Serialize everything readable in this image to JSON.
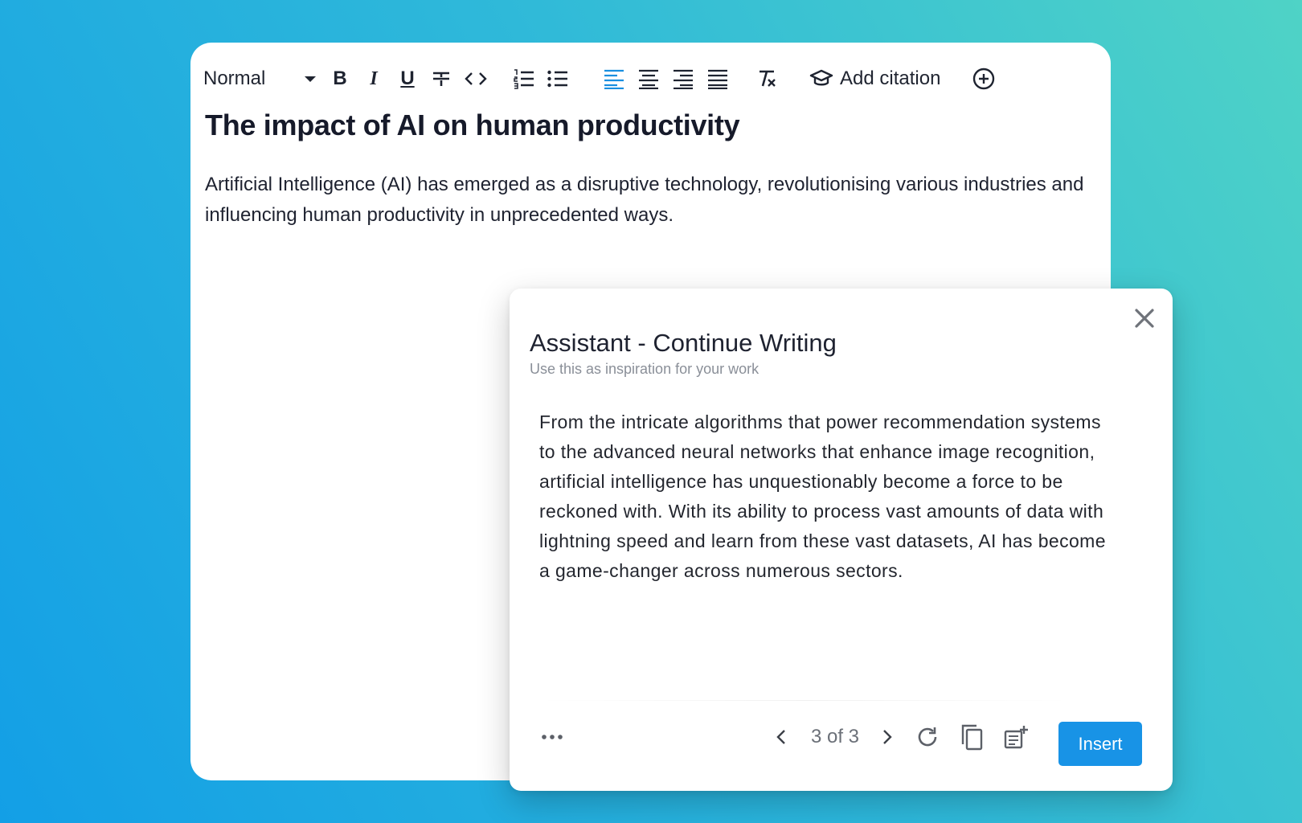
{
  "toolbar": {
    "style_select": {
      "value": "Normal"
    },
    "bold_label": "B",
    "italic_label": "I",
    "underline_label": "U",
    "add_citation_label": "Add citation",
    "icons": [
      "chevron-down-icon",
      "strikethrough-icon",
      "code-icon",
      "ordered-list-icon",
      "bullet-list-icon",
      "align-left-icon",
      "align-center-icon",
      "align-right-icon",
      "align-justify-icon",
      "clear-format-icon",
      "graduation-cap-icon",
      "plus-circle-icon"
    ],
    "active_color": "#1a8fe0"
  },
  "document": {
    "title": "The impact of AI on human productivity",
    "paragraph": "Artificial Intelligence (AI) has emerged as a disruptive technology, revolutionising various industries and influencing human productivity in unprecedented ways."
  },
  "assistant": {
    "title": "Assistant - Continue Writing",
    "subtitle": "Use this as inspiration for your work",
    "suggestion": "From the intricate algorithms that power recommendation systems to the advanced neural networks that enhance image recognition, artificial intelligence has unquestionably become a force to be reckoned with. With its ability to process vast amounts of data with lightning speed and learn from these vast datasets, AI has become a game-changer across numerous sectors.",
    "pagination": "3 of 3",
    "insert_label": "Insert",
    "icons": [
      "close-icon",
      "more-icon",
      "chevron-left-icon",
      "chevron-right-icon",
      "refresh-icon",
      "copy-icon",
      "add-note-icon"
    ],
    "accent": "#1893e6"
  }
}
